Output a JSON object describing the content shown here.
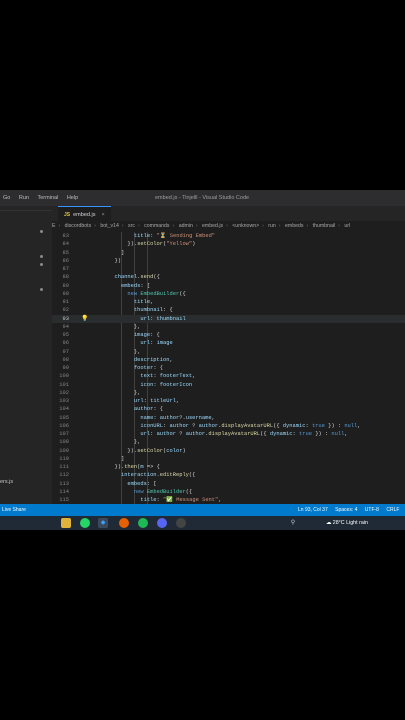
{
  "window": {
    "menu": [
      "Go",
      "Run",
      "Terminal",
      "Help"
    ],
    "title": "embed.js - Tinjelll - Visual Studio Code"
  },
  "sidebar": {
    "file_fragment": "ers.js"
  },
  "tab": {
    "label": "embed.js",
    "icon": "js-file-icon"
  },
  "breadcrumb": [
    "E",
    "discordbots",
    "bot_v14",
    "src",
    "commands",
    "admin",
    "embed.js",
    "<unknown>",
    "run",
    "embeds",
    "thumbnail",
    "url"
  ],
  "editor": {
    "active_line": "93",
    "lines": [
      {
        "n": "83",
        "t": "        title: \"⏳ Sending Embed\""
      },
      {
        "n": "84",
        "t": "      }).setColor(\"Yellow\")"
      },
      {
        "n": "85",
        "t": "    ]"
      },
      {
        "n": "86",
        "t": "  })"
      },
      {
        "n": "87",
        "t": ""
      },
      {
        "n": "88",
        "t": "  channel.send({"
      },
      {
        "n": "89",
        "t": "    embeds: ["
      },
      {
        "n": "90",
        "t": "      new EmbedBuilder({"
      },
      {
        "n": "91",
        "t": "        title,"
      },
      {
        "n": "92",
        "t": "        thumbnail: {"
      },
      {
        "n": "93",
        "t": "          url: thumbnail"
      },
      {
        "n": "94",
        "t": "        },"
      },
      {
        "n": "95",
        "t": "        image: {"
      },
      {
        "n": "96",
        "t": "          url: image"
      },
      {
        "n": "97",
        "t": "        },"
      },
      {
        "n": "98",
        "t": "        description,"
      },
      {
        "n": "99",
        "t": "        footer: {"
      },
      {
        "n": "100",
        "t": "          text: footerText,"
      },
      {
        "n": "101",
        "t": "          icon: footerIcon"
      },
      {
        "n": "102",
        "t": "        },"
      },
      {
        "n": "103",
        "t": "        url: titleUrl,"
      },
      {
        "n": "104",
        "t": "        author: {"
      },
      {
        "n": "105",
        "t": "          name: author?.username,"
      },
      {
        "n": "106",
        "t": "          iconURL: author ? author.displayAvatarURL({ dynamic: true }) : null,"
      },
      {
        "n": "107",
        "t": "          url: author ? author.displayAvatarURL({ dynamic: true }) : null,"
      },
      {
        "n": "108",
        "t": "        },"
      },
      {
        "n": "109",
        "t": "      }).setColor(color)"
      },
      {
        "n": "110",
        "t": "    ]"
      },
      {
        "n": "111",
        "t": "  }).then(m => {"
      },
      {
        "n": "112",
        "t": "    interaction.editReply({"
      },
      {
        "n": "113",
        "t": "      embeds: ["
      },
      {
        "n": "114",
        "t": "        new EmbedBuilder({"
      },
      {
        "n": "115",
        "t": "          title: \"✅ Message Sent\","
      }
    ]
  },
  "status": {
    "live_share": "Live Share",
    "position": "Ln 93, Col 37",
    "spaces": "Spaces: 4",
    "encoding": "UTF-8",
    "eol": "CRLF"
  },
  "taskbar": {
    "weather_temp": "28°C",
    "weather_text": "Light rain",
    "icons": [
      "folder-icon",
      "whatsapp-icon",
      "vscode-icon",
      "firefox-icon",
      "spotify-icon",
      "discord-icon",
      "obs-icon"
    ]
  },
  "colors": {
    "accent": "#007acc",
    "editor_bg": "#1e1e1e"
  }
}
